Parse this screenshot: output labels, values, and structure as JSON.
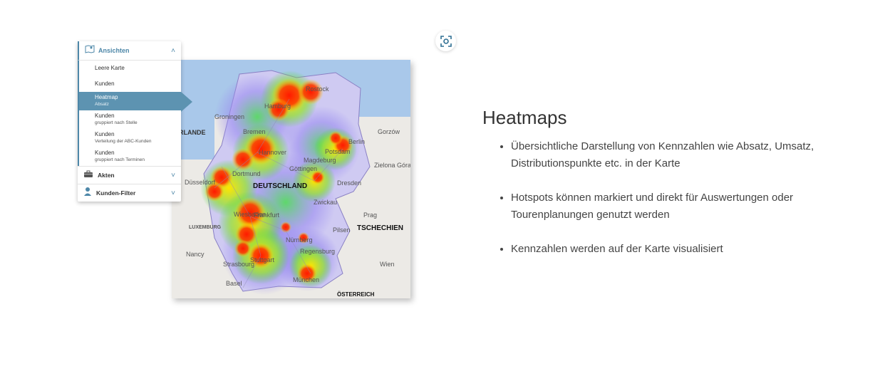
{
  "panel": {
    "header": {
      "label": "Ansichten",
      "icon": "map-icon",
      "expanded": true
    },
    "items": [
      {
        "label": "Leere Karte",
        "sub": ""
      },
      {
        "label": "Kunden",
        "sub": ""
      },
      {
        "label": "Heatmap",
        "sub": "Absatz",
        "active": true
      },
      {
        "label": "Kunden",
        "sub": "gruppiert nach Stelle"
      },
      {
        "label": "Kunden",
        "sub": "Verteilung der ABC-Kunden"
      },
      {
        "label": "Kunden",
        "sub": "gruppiert nach Terminen"
      }
    ],
    "sections": [
      {
        "label": "Akten",
        "icon": "briefcase-icon"
      },
      {
        "label": "Kunden-Filter",
        "icon": "user-icon"
      }
    ]
  },
  "map": {
    "labels": [
      "Rostock",
      "Hamburg",
      "Bremen",
      "Berlin",
      "Hannover",
      "Potsdam",
      "Magdeburg",
      "Göttingen",
      "Dortmund",
      "Düsseldorf",
      "DEUTSCHLAND",
      "Dresden",
      "Frankfurt",
      "Nürnberg",
      "Prag",
      "TSCHECHIEN",
      "Stuttgart",
      "München",
      "Wien",
      "ÖSTERREICH",
      "ERLANDE",
      "Nancy",
      "Groningen",
      "LUXEMBURG",
      "Strasbourg",
      "Basel",
      "Regensburg",
      "Wiesbaden",
      "Zwickau",
      "Pilsen",
      "Gorzów",
      "Zielona Góra"
    ],
    "colors": {
      "hot": "#ff1a00",
      "warm": "#ffe600",
      "mid": "#4cd640",
      "cool": "#9a8cf0"
    }
  },
  "content": {
    "title": "Heatmaps",
    "bullets": [
      "Übersichtliche Darstellung von Kennzahlen wie Absatz, Umsatz, Distributionspunkte etc. in der Karte",
      "Hotspots können markiert und direkt für Auswertungen oder Tourenplanungen genutzt werden",
      "Kennzahlen werden auf der Karte visualisiert"
    ]
  },
  "focus_button": {
    "icon": "focus-camera-icon"
  }
}
